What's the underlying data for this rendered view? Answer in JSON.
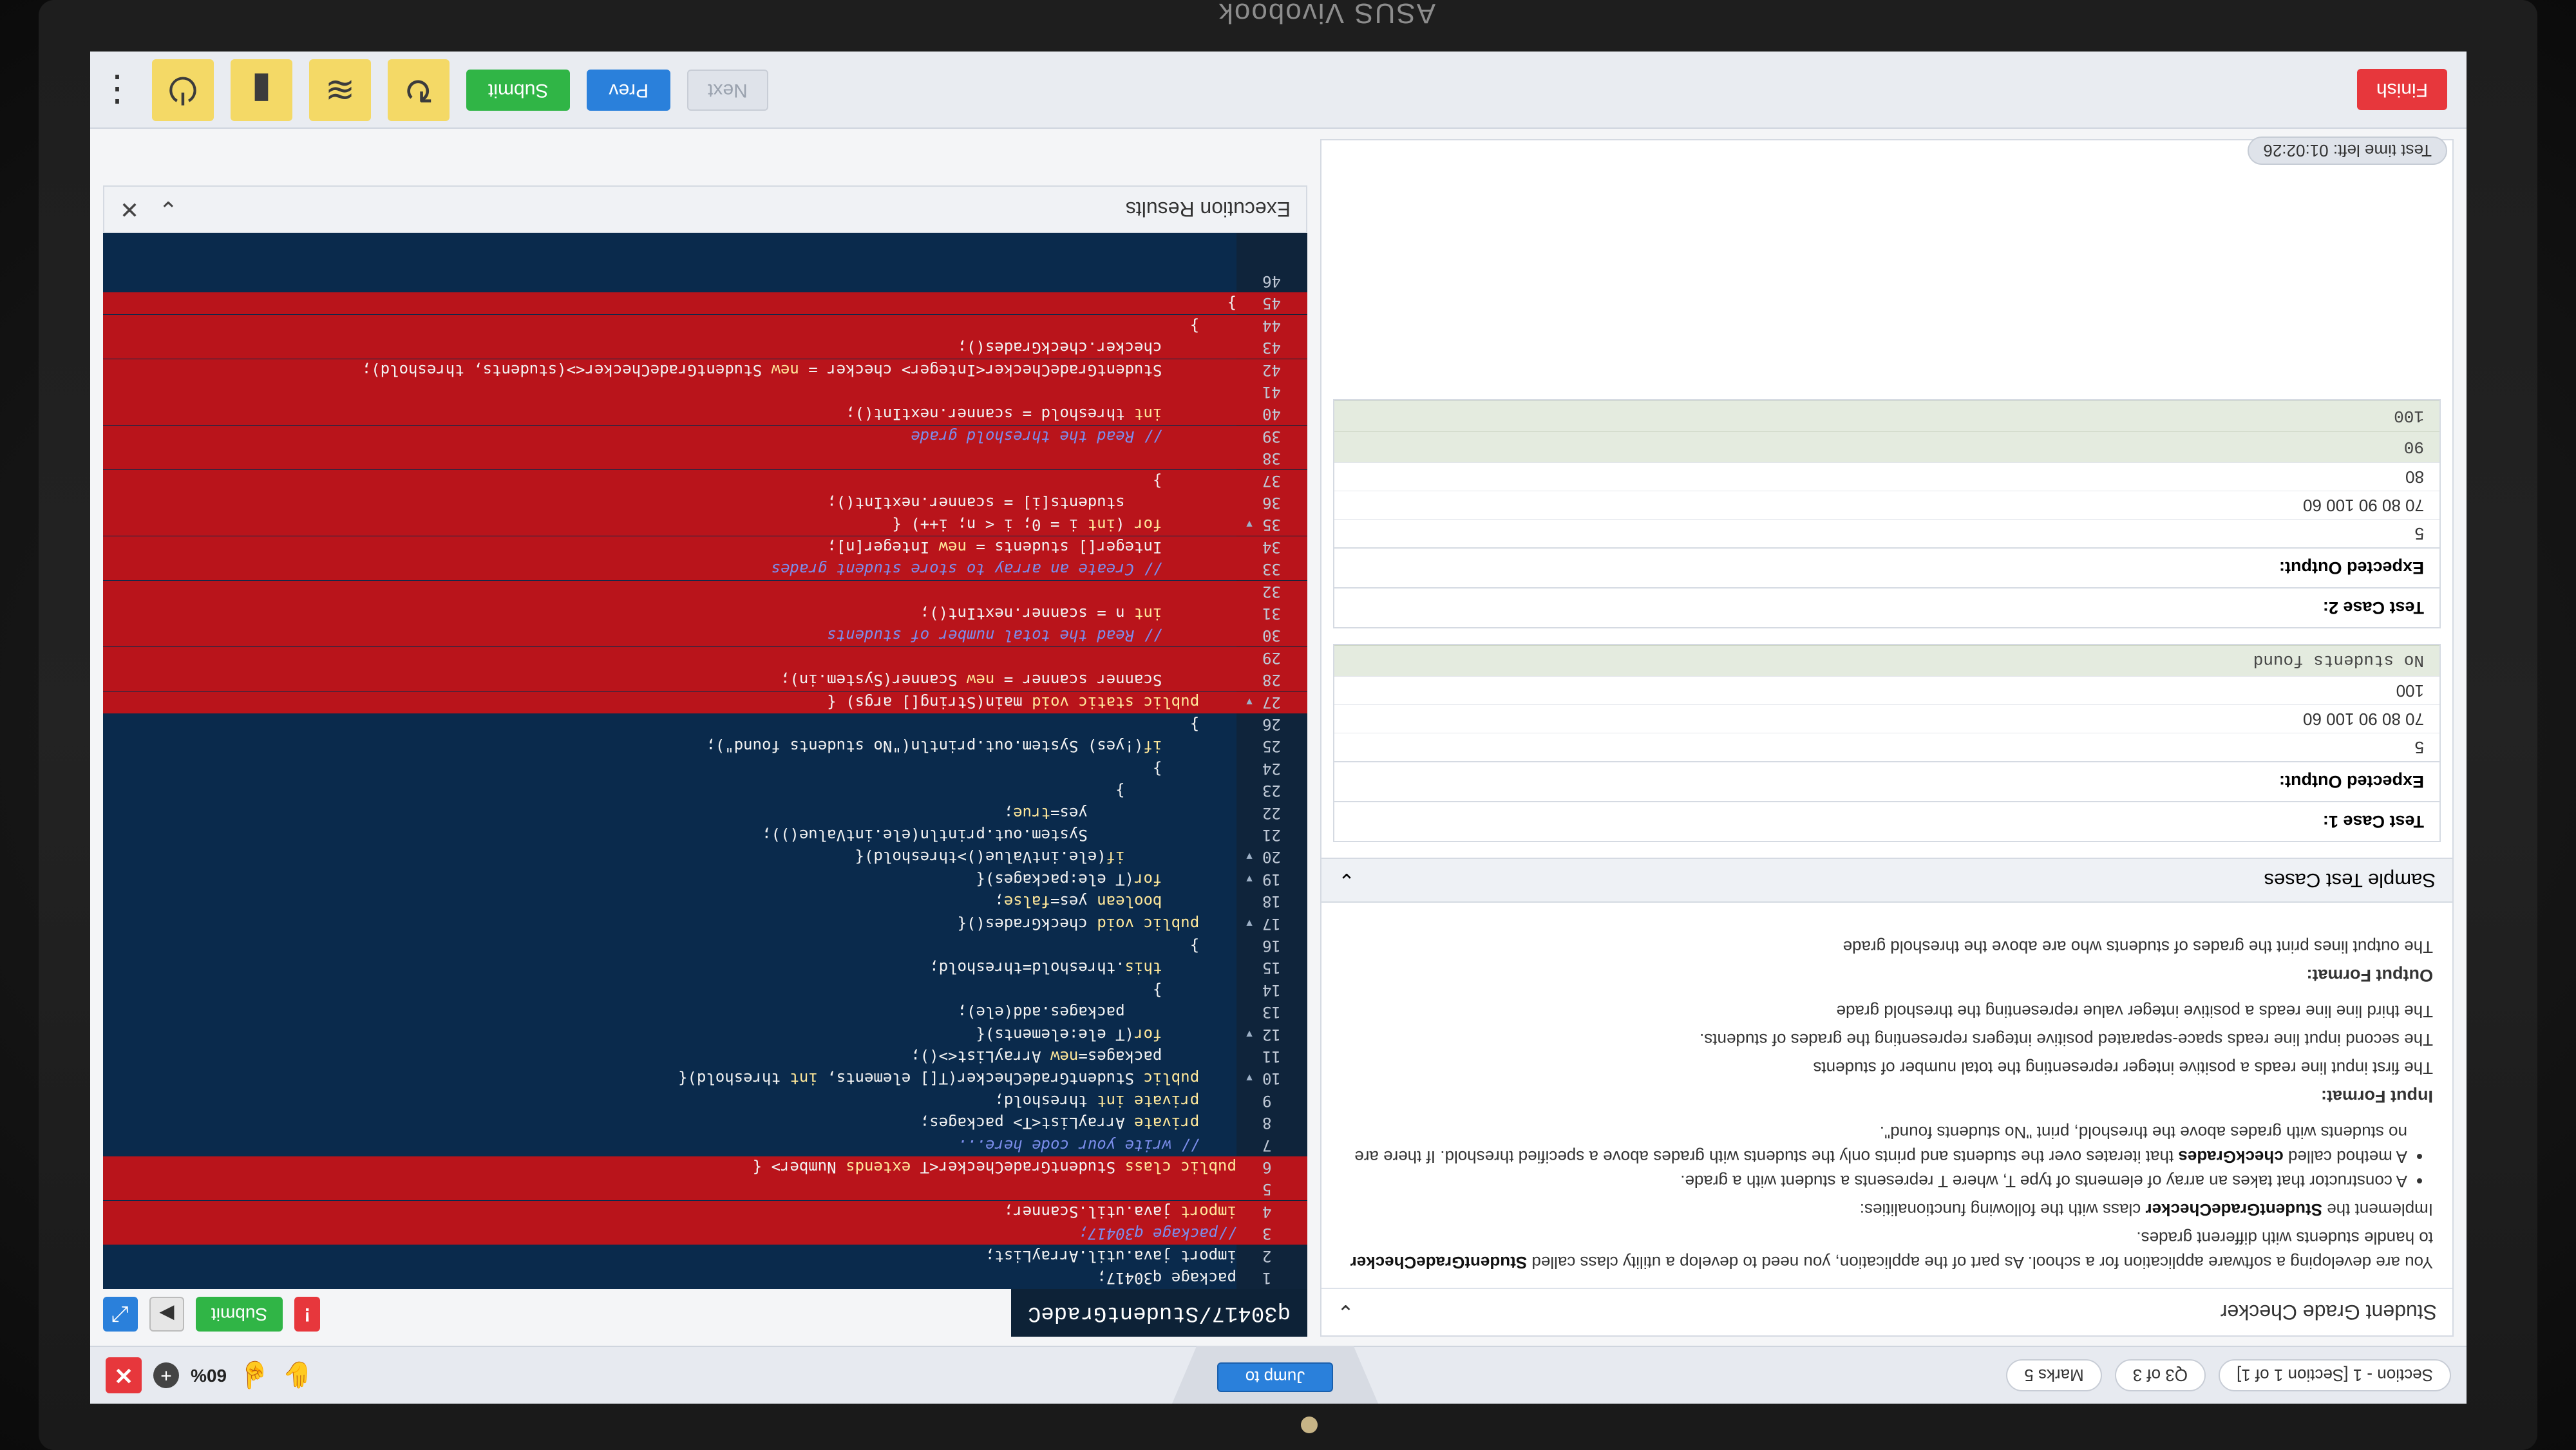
{
  "device": {
    "brand": "ASUS Vivobook"
  },
  "topbar": {
    "section": "Section - 1 [Section 1 of 1]",
    "question": "Q3 of 3",
    "marks": "Marks 5",
    "jump": "Jump to",
    "zoom": "60%",
    "plus": "+",
    "close": "✕"
  },
  "question": {
    "title": "Student Grade Checker",
    "intro": "You are developing a software application for a school. As part of the application, you need to develop a utility class called",
    "intro_bold": "StudentGradeChecker",
    "intro_rest": "to handle students with different grades.",
    "implement_pre": "Implement the",
    "implement_bold": "StudentGradeChecker",
    "implement_post": "class with the following functionalities:",
    "bullet1": "A constructor that takes an array of elements of type T, where T represents a student with a grade.",
    "bullet2_pre": "A method called",
    "bullet2_bold": "checkGrades",
    "bullet2_post": "that iterates over the students and prints only the students with grades above a specified threshold. If there are no students with grades above the threshold, print \"No students found\".",
    "input_heading": "Input Format:",
    "input1": "The first input line reads a positive integer representing the total number of students",
    "input2": "The second input line reads space-separated positive integers representing the grades of students.",
    "input3": "The third line line reads a positive integer value representing the threshold grade",
    "output_heading": "Output Format:",
    "output1": "The output lines print the grades of students who are above the threshold grade",
    "tests_heading": "Sample Test Cases",
    "tc1": {
      "title": "Test Case 1:",
      "expected": "Expected Output:",
      "in1": "5",
      "in2": "70 80 90 100 60",
      "in3": "100",
      "out1": "No students found"
    },
    "tc2": {
      "title": "Test Case 2:",
      "expected": "Expected Output:",
      "in1": "5",
      "in2": "70 80 90 100 60",
      "in3": "80",
      "out1": "90",
      "out2": "100"
    }
  },
  "editor": {
    "file": "q30417/StudentGradeC",
    "submit": "Submit",
    "warn": "!",
    "play": "▶",
    "expand": "⤢",
    "exec_title": "Execution Results"
  },
  "bottom": {
    "time_left": "Test time left: 01:02:26",
    "finish": "Finish",
    "next": "Next",
    "prev": "Prev",
    "submit": "Submit"
  }
}
